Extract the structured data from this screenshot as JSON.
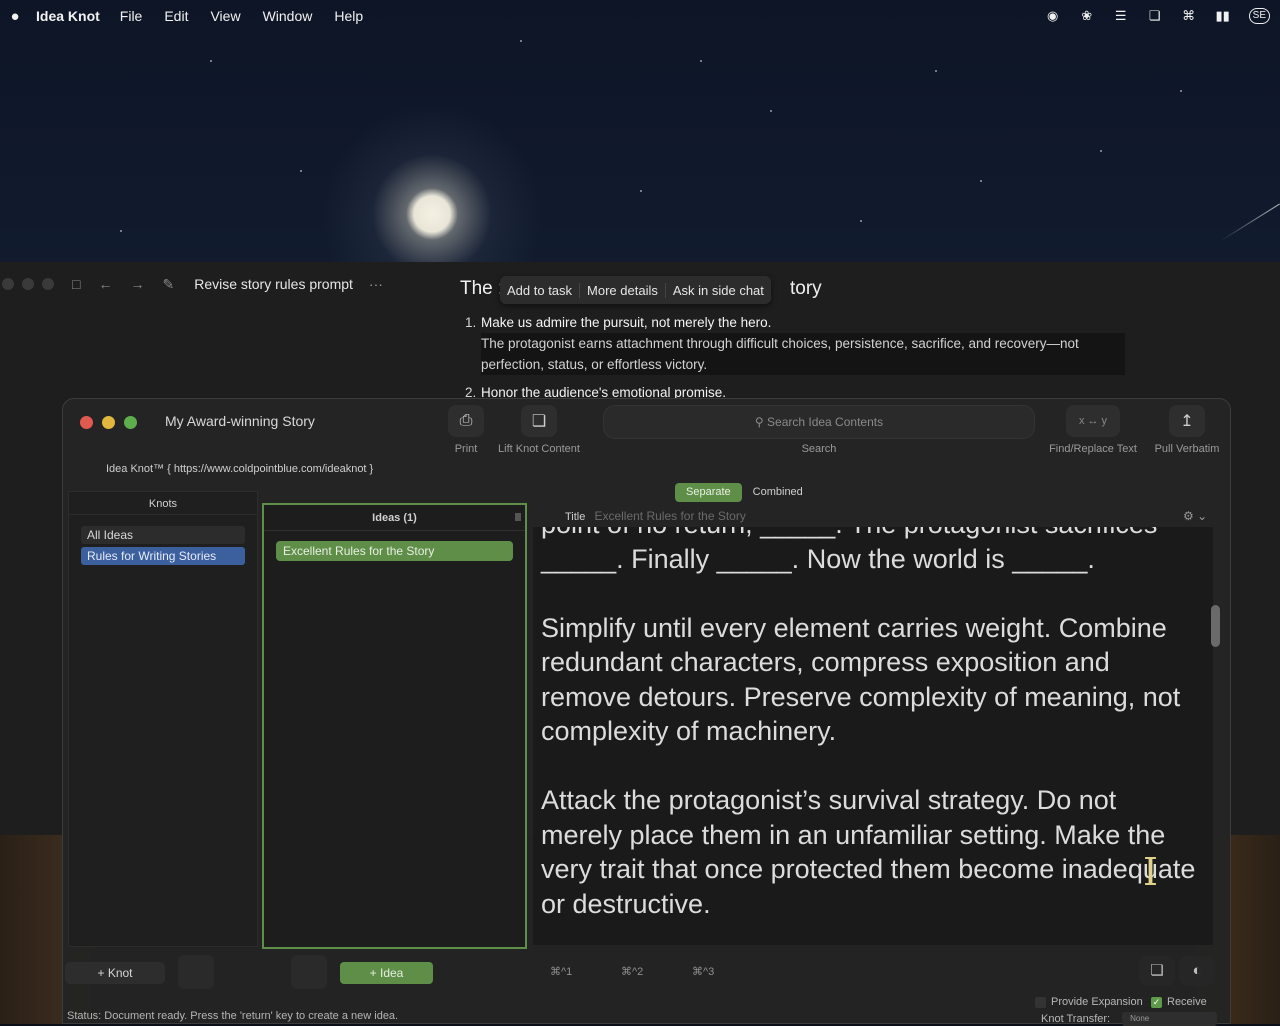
{
  "menubar": {
    "app_name": "Idea Knot",
    "items": [
      "File",
      "Edit",
      "View",
      "Window",
      "Help"
    ],
    "status_icons": [
      "record-icon",
      "openai-icon",
      "plugin-icon",
      "screens-icon",
      "wifi-icon",
      "battery-icon"
    ],
    "input_badge": "SE"
  },
  "chat": {
    "title": "Revise story rules prompt",
    "more": "···",
    "heading_start": "The :",
    "heading_end": "tory",
    "popup": [
      "Add to task",
      "More details",
      "Ask in side chat"
    ],
    "list": [
      {
        "num": "1.",
        "bold": "Make us admire the pursuit, not merely the hero.",
        "sub": "The protagonist earns attachment through difficult choices, persistence, sacrifice, and recovery—not perfection, status, or effortless victory."
      },
      {
        "num": "2.",
        "bold": "Honor the audience's emotional promise."
      }
    ]
  },
  "ik": {
    "window_title": "My Award-winning Story",
    "url": "Idea Knot™ { https://www.coldpointblue.com/ideaknot }",
    "toolbar": {
      "print": "Print",
      "lift": "Lift Knot Content",
      "search_placeholder": "Search Idea Contents",
      "search_label": "Search",
      "find_replace": "Find/Replace Text",
      "find_glyph": "x ↔ y",
      "pull": "Pull Verbatim"
    },
    "seg": {
      "separate": "Separate",
      "combined": "Combined"
    },
    "knots": {
      "header": "Knots",
      "items": [
        "All Ideas",
        "Rules for Writing Stories"
      ]
    },
    "ideas": {
      "header": "Ideas (1)",
      "items": [
        "Excellent Rules for the Story"
      ]
    },
    "editor": {
      "title_label": "Title",
      "title_placeholder": "Excellent Rules for the Story",
      "paragraphs": [
        "point of no return, _____. The protagonist sacrifices _____. Finally _____. Now the world is _____.",
        "Simplify until every element carries weight. Combine redundant characters, compress exposition and remove detours. Preserve complexity of meaning, not complexity of machinery.",
        "Attack the protagonist’s survival strategy. Do not merely place them in an unfamiliar setting. Make the very trait that once protected them become inadequate or destructive."
      ]
    },
    "bottom": {
      "add_knot": "+ Knot",
      "add_idea": "+ Idea",
      "hotkeys": [
        "⌘^1",
        "⌘^2",
        "⌘^3"
      ],
      "status": "Status: Document ready. Press the 'return' key to create a new idea.",
      "provide_expansion": "Provide Expansion",
      "receive": "Receive",
      "knot_transfer": "Knot Transfer:",
      "knot_transfer_value": "None"
    }
  }
}
